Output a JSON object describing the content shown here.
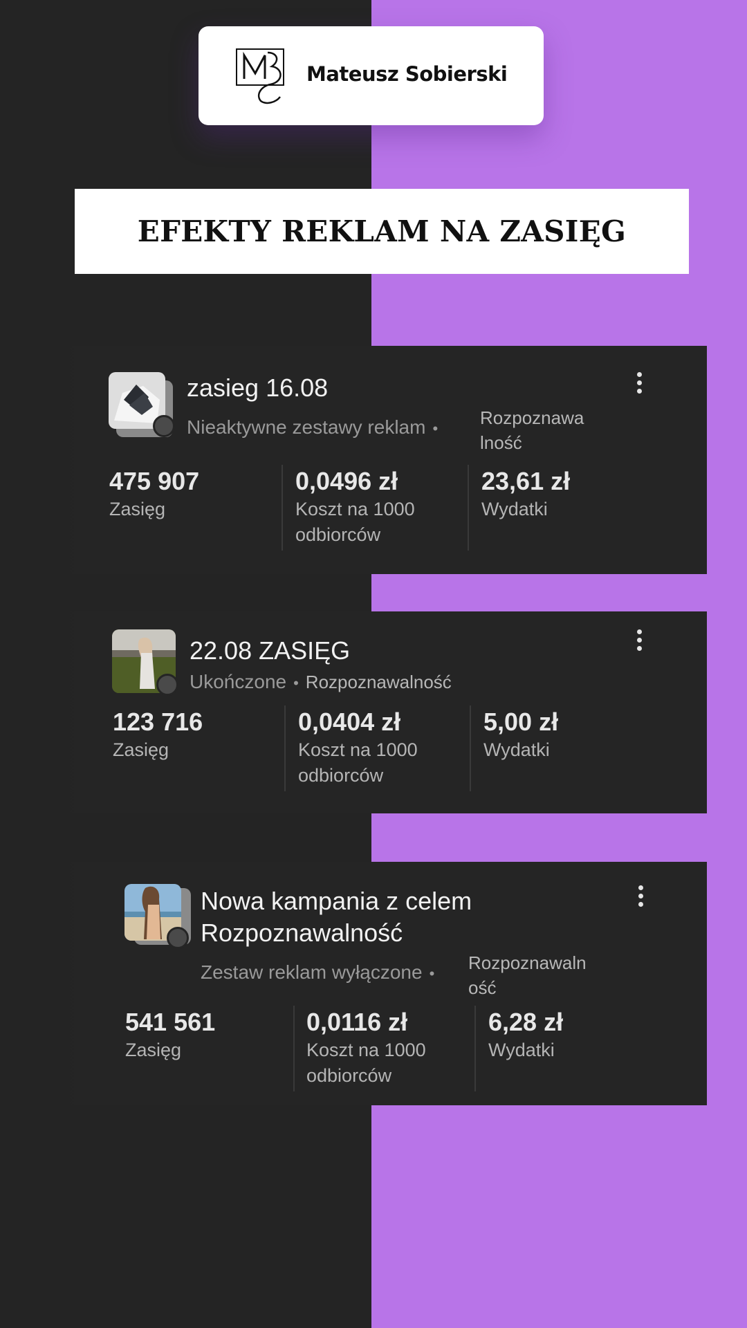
{
  "brand": {
    "name": "Mateusz Sobierski"
  },
  "header": {
    "title": "EFEKTY REKLAM NA ZASIĘG"
  },
  "campaigns": [
    {
      "name": "zasieg 16.08",
      "status": "Nieaktywne zestawy reklam",
      "objective_line1": "Rozpoznawa",
      "objective_line2": "lność",
      "metrics": [
        {
          "value": "475 907",
          "label": "Zasięg"
        },
        {
          "value": "0,0496 zł",
          "label_line1": "Koszt na 1000",
          "label_line2": "odbiorców"
        },
        {
          "value": "23,61 zł",
          "label": "Wydatki"
        }
      ]
    },
    {
      "name": "22.08 ZASIĘG",
      "status": "Ukończone",
      "objective": "Rozpoznawalność",
      "metrics": [
        {
          "value": "123 716",
          "label": "Zasięg"
        },
        {
          "value": "0,0404 zł",
          "label_line1": "Koszt na 1000",
          "label_line2": "odbiorców"
        },
        {
          "value": "5,00 zł",
          "label": "Wydatki"
        }
      ]
    },
    {
      "name_line1": "Nowa kampania z celem",
      "name_line2": "Rozpoznawalność",
      "status": "Zestaw reklam wyłączone",
      "objective_line1": "Rozpoznawaln",
      "objective_line2": "ość",
      "metrics": [
        {
          "value": "541 561",
          "label": "Zasięg"
        },
        {
          "value": "0,0116 zł",
          "label_line1": "Koszt na 1000",
          "label_line2": "odbiorców"
        },
        {
          "value": "6,28 zł",
          "label": "Wydatki"
        }
      ]
    }
  ],
  "colors": {
    "dark_bg": "#242424",
    "purple_bg": "#b874e8",
    "card_bg": "#252525"
  },
  "icons": {
    "menu": "more-vertical-icon",
    "status": "status-dot-icon"
  }
}
